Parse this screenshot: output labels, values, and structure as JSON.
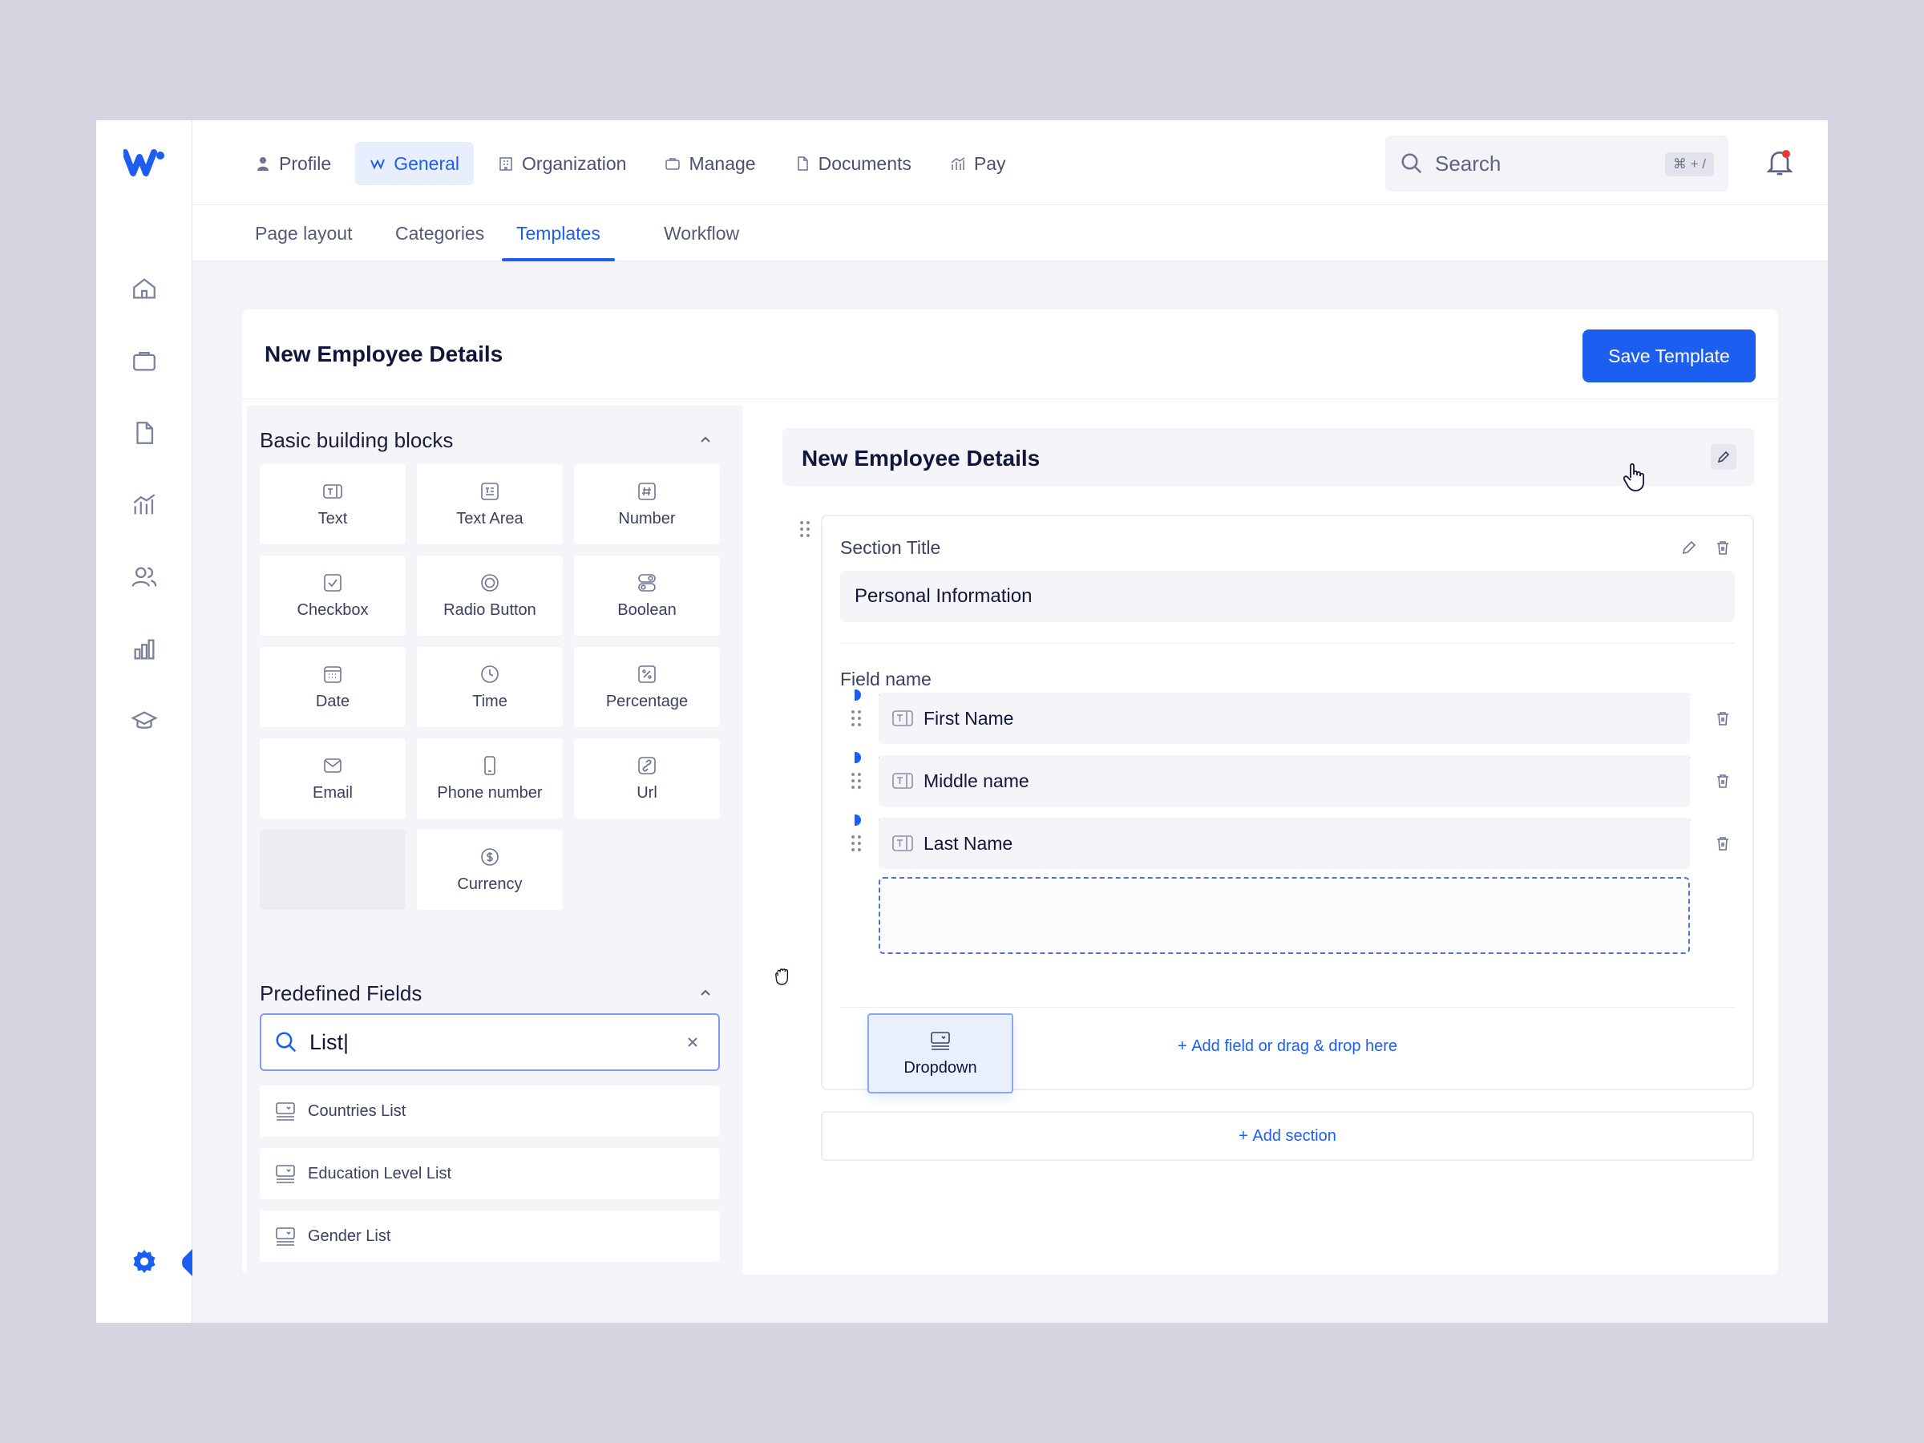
{
  "colors": {
    "accent": "#1c5ff0",
    "background": "#d5d5e2",
    "surface": "#ffffff",
    "muted_surface": "#f5f5f9"
  },
  "top_nav": [
    {
      "label": "Profile",
      "icon": "user-icon"
    },
    {
      "label": "General",
      "icon": "general-icon",
      "active": true
    },
    {
      "label": "Organization",
      "icon": "building-icon"
    },
    {
      "label": "Manage",
      "icon": "briefcase-icon"
    },
    {
      "label": "Documents",
      "icon": "document-icon"
    },
    {
      "label": "Pay",
      "icon": "pay-icon"
    }
  ],
  "search": {
    "placeholder": "Search",
    "shortcut": "⌘ + /"
  },
  "sub_tabs": [
    {
      "label": "Page layout"
    },
    {
      "label": "Categories"
    },
    {
      "label": "Templates",
      "active": true
    },
    {
      "label": "Workflow"
    }
  ],
  "header": {
    "title": "New Employee Details",
    "save_label": "Save Template"
  },
  "basic_blocks": {
    "heading": "Basic building blocks",
    "items": [
      {
        "label": "Text",
        "icon": "text-field-icon"
      },
      {
        "label": "Text Area",
        "icon": "text-area-icon"
      },
      {
        "label": "Number",
        "icon": "hash-icon"
      },
      {
        "label": "Checkbox",
        "icon": "checkbox-icon"
      },
      {
        "label": "Radio Button",
        "icon": "radio-icon"
      },
      {
        "label": "Boolean",
        "icon": "toggle-icon"
      },
      {
        "label": "Date",
        "icon": "calendar-icon"
      },
      {
        "label": "Time",
        "icon": "clock-icon"
      },
      {
        "label": "Percentage",
        "icon": "percent-icon"
      },
      {
        "label": "Email",
        "icon": "mail-icon"
      },
      {
        "label": "Phone number",
        "icon": "phone-icon"
      },
      {
        "label": "Url",
        "icon": "link-icon"
      },
      {
        "label": "Currency",
        "icon": "currency-icon"
      }
    ]
  },
  "predefined_fields": {
    "heading": "Predefined Fields",
    "search_value": "List|",
    "items": [
      {
        "label": "Countries List",
        "icon": "dropdown-icon"
      },
      {
        "label": "Education Level List",
        "icon": "dropdown-icon"
      },
      {
        "label": "Gender List",
        "icon": "dropdown-icon"
      }
    ]
  },
  "editor": {
    "title": "New Employee Details",
    "section_title_label": "Section Title",
    "section_title_value": "Personal Information",
    "field_name_label": "Field name",
    "fields": [
      {
        "label": "First Name",
        "icon": "text-field-icon"
      },
      {
        "label": "Middle name",
        "icon": "text-field-icon"
      },
      {
        "label": "Last Name",
        "icon": "text-field-icon"
      }
    ],
    "add_field_label": "Add field or drag & drop here",
    "add_section_label": "Add section"
  },
  "dragging": {
    "label": "Dropdown",
    "icon": "dropdown-icon"
  }
}
